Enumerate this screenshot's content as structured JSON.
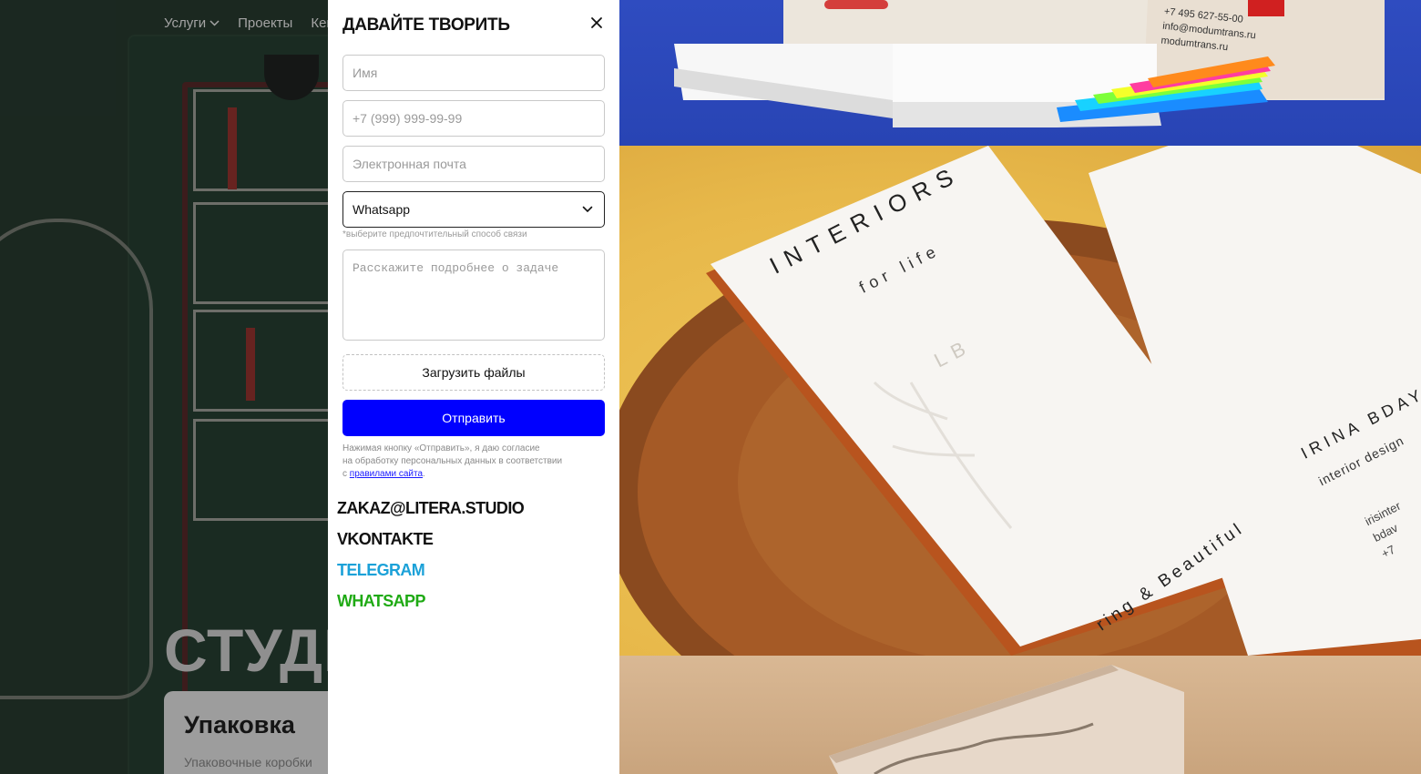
{
  "background": {
    "nav": [
      {
        "label": "Услуги",
        "has_dropdown": true
      },
      {
        "label": "Проекты",
        "has_dropdown": false
      },
      {
        "label": "Кей",
        "has_dropdown": false
      }
    ],
    "hero_text": "СТУДИ",
    "card": {
      "title": "Упаковка",
      "subtitle": "Упаковочные коробки"
    }
  },
  "modal": {
    "title": "ДАВАЙТЕ ТВОРИТЬ",
    "close_icon": "close-icon",
    "form": {
      "name_placeholder": "Имя",
      "phone_placeholder": "+7 (999) 999-99-99",
      "email_placeholder": "Электронная почта",
      "contact_method": "Whatsapp",
      "contact_method_hint": "*выберите предпочтительный способ связи",
      "task_placeholder": "Расскажите подробнее о задаче",
      "upload_label": "Загрузить файлы",
      "submit_label": "Отправить",
      "consent_line1": "Нажимая кнопку «Отправить», я даю согласие",
      "consent_line2": "на обработку персональных данных в соответствии",
      "consent_prefix": "с ",
      "consent_link": "правилами сайта",
      "consent_suffix": "."
    },
    "contacts": [
      {
        "label": "ZAKAZ@LITERA.STUDIO",
        "color": "#111111"
      },
      {
        "label": "VKONTAKTE",
        "color": "#111111"
      },
      {
        "label": "TELEGRAM",
        "color": "#1ba1d8"
      },
      {
        "label": "WHATSAPP",
        "color": "#1faa14"
      }
    ]
  },
  "gallery": {
    "photo1": {
      "phone": "+7 495 627-55-00",
      "email": "info@modumtrans.ru",
      "site": "modumtrans.ru",
      "sticky_colors": [
        "#ff8a1c",
        "#ff3da0",
        "#f4ff2a",
        "#7dff3a",
        "#18d2ff",
        "#1a8cff"
      ]
    },
    "photo2": {
      "card_brand": "INTERIORS",
      "card_tagline": "for life",
      "card_monogram": "LB",
      "card_motto": "ring & Beautiful",
      "second_name": "IRINA BDAY",
      "second_role": "interior design",
      "second_handle": "irisinter",
      "second_handle2": "bdav",
      "second_phone": "+7"
    }
  }
}
